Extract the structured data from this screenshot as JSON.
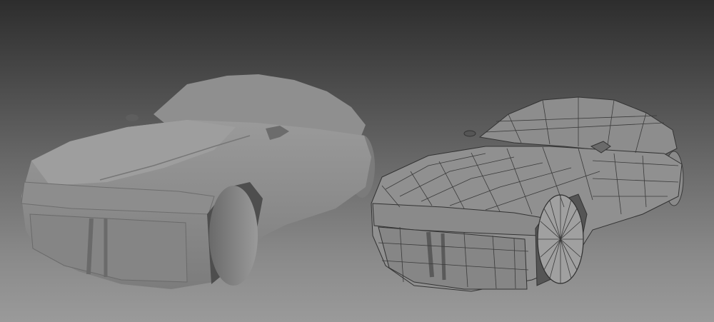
{
  "viewport": {
    "background_top": "#2d2d2d",
    "background_bottom": "#9a9a9a"
  },
  "models": [
    {
      "name": "car-shaded",
      "render": "shaded",
      "color": "#8c8c8c"
    },
    {
      "name": "car-wireframe",
      "render": "shaded-wireframe",
      "color": "#8e8e8e",
      "wire_color": "#3a3a3a"
    }
  ]
}
